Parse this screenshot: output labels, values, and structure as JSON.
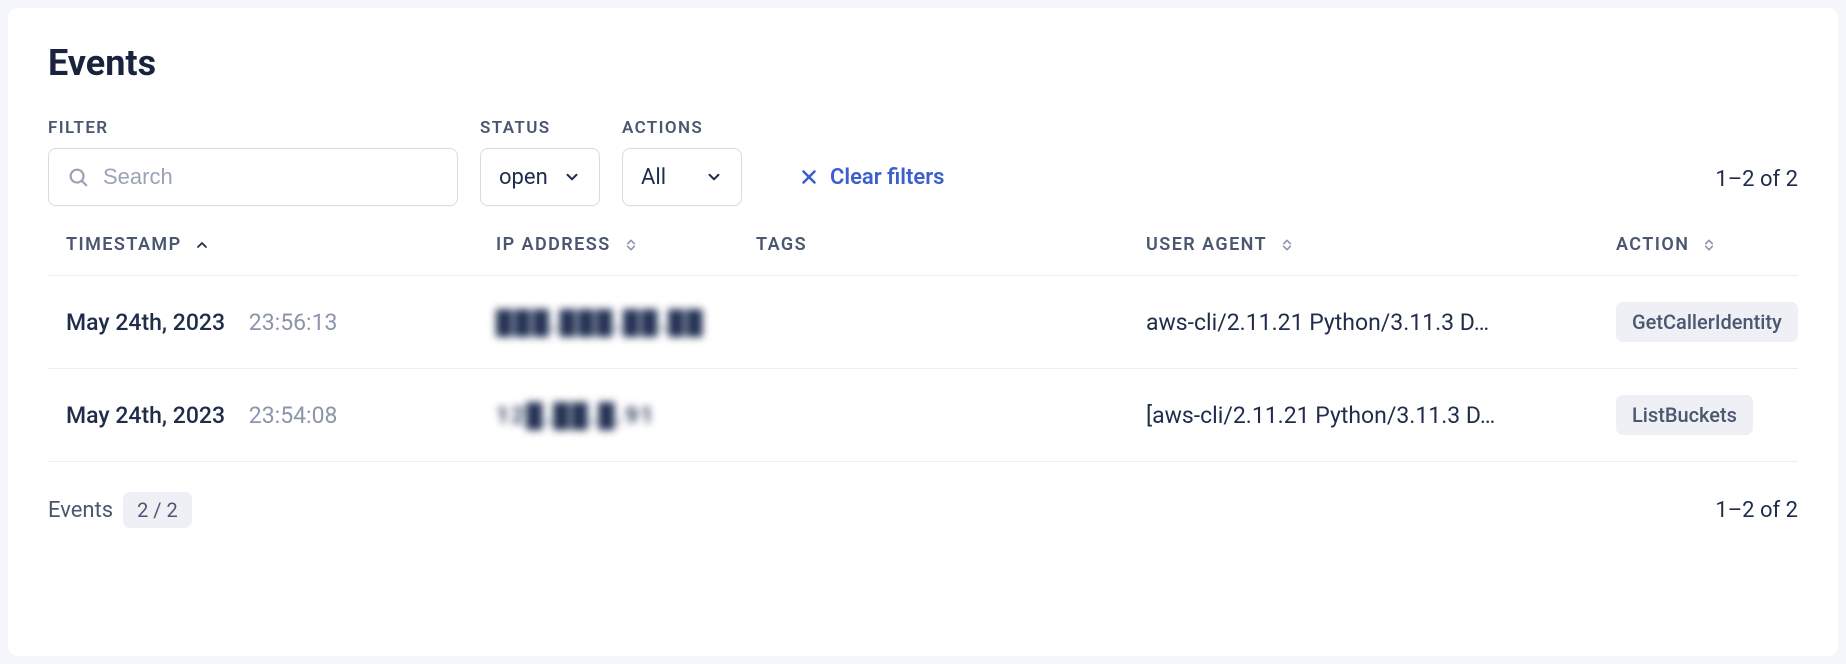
{
  "title": "Events",
  "filters": {
    "filter_label": "FILTER",
    "search_placeholder": "Search",
    "status_label": "STATUS",
    "status_value": "open",
    "actions_label": "ACTIONS",
    "actions_value": "All",
    "clear_label": "Clear filters"
  },
  "pagination": {
    "top_range": "1–2 of 2",
    "bottom_range": "1–2 of 2",
    "events_word": "Events",
    "events_count": "2 / 2"
  },
  "columns": {
    "timestamp": "TIMESTAMP",
    "ip": "IP ADDRESS",
    "tags": "TAGS",
    "user_agent": "USER AGENT",
    "action": "ACTION"
  },
  "rows": [
    {
      "date": "May 24th, 2023",
      "time": "23:56:13",
      "ip": "███.███.██.██",
      "tags": "",
      "user_agent": "aws-cli/2.11.21 Python/3.11.3 D…",
      "action": "GetCallerIdentity"
    },
    {
      "date": "May 24th, 2023",
      "time": "23:54:08",
      "ip": "12█.██.█.91",
      "tags": "",
      "user_agent": "[aws-cli/2.11.21 Python/3.11.3 D…",
      "action": "ListBuckets"
    }
  ]
}
